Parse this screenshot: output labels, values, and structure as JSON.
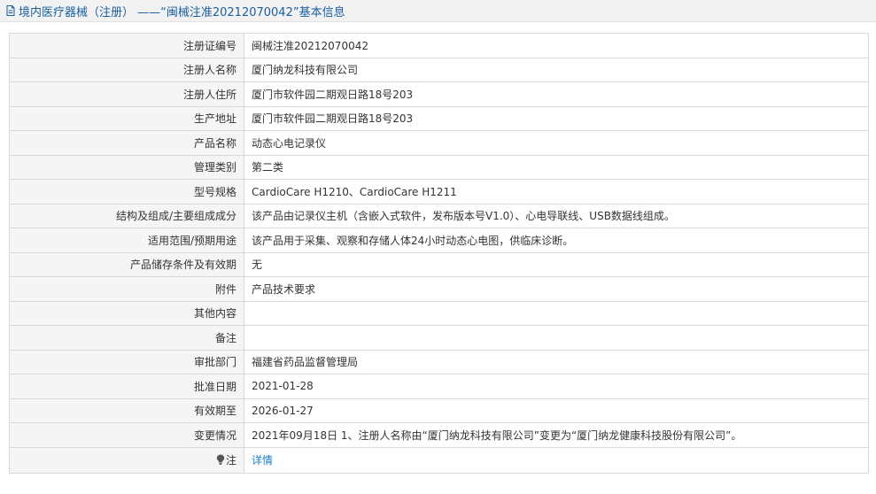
{
  "header": {
    "title": "境内医疗器械（注册） ——“闽械注准20212070042”基本信息",
    "icon": "document-icon",
    "color": "#1a5fa0"
  },
  "rows": [
    {
      "label": "注册证编号",
      "value": "闽械注准20212070042"
    },
    {
      "label": "注册人名称",
      "value": "厦门纳龙科技有限公司"
    },
    {
      "label": "注册人住所",
      "value": "厦门市软件园二期观日路18号203"
    },
    {
      "label": "生产地址",
      "value": "厦门市软件园二期观日路18号203"
    },
    {
      "label": "产品名称",
      "value": "动态心电记录仪"
    },
    {
      "label": "管理类别",
      "value": "第二类"
    },
    {
      "label": "型号规格",
      "value": "CardioCare H1210、CardioCare H1211"
    },
    {
      "label": "结构及组成/主要组成成分",
      "value": "该产品由记录仪主机（含嵌入式软件，发布版本号V1.0）、心电导联线、USB数据线组成。"
    },
    {
      "label": "适用范围/预期用途",
      "value": "该产品用于采集、观察和存储人体24小时动态心电图，供临床诊断。"
    },
    {
      "label": "产品储存条件及有效期",
      "value": "无"
    },
    {
      "label": "附件",
      "value": "产品技术要求"
    },
    {
      "label": "其他内容",
      "value": ""
    },
    {
      "label": "备注",
      "value": ""
    },
    {
      "label": "审批部门",
      "value": "福建省药品监督管理局"
    },
    {
      "label": "批准日期",
      "value": "2021-01-28"
    },
    {
      "label": "有效期至",
      "value": "2026-01-27"
    },
    {
      "label": "变更情况",
      "value": "2021年09月18日 1、注册人名称由“厦门纳龙科技有限公司”变更为“厦门纳龙健康科技股份有限公司”。"
    }
  ],
  "note": {
    "label": "注",
    "icon": "lightbulb-icon",
    "link_text": "详情",
    "link_color": "#1a7ec4"
  }
}
